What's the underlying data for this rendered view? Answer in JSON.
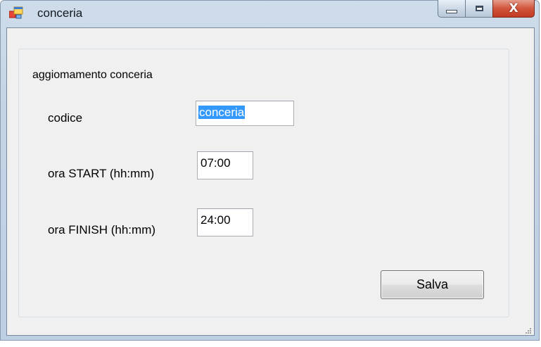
{
  "window": {
    "title": "conceria",
    "icons": {
      "app": "form-icon",
      "minimize": "minimize-icon",
      "maximize": "maximize-icon",
      "close": "close-icon"
    },
    "close_glyph": "X"
  },
  "group": {
    "title": "aggiomamento conceria"
  },
  "fields": {
    "codice": {
      "label": "codice",
      "value": "conceria",
      "selected": true
    },
    "ora_start": {
      "label": "ora START (hh:mm)",
      "value": "07:00"
    },
    "ora_finish": {
      "label": "ora FINISH (hh:mm)",
      "value": "24:00"
    }
  },
  "buttons": {
    "save_label": "Salva"
  },
  "colors": {
    "selection": "#3399ff",
    "client_bg": "#f0f0f0",
    "close_button": "#c23a22"
  }
}
